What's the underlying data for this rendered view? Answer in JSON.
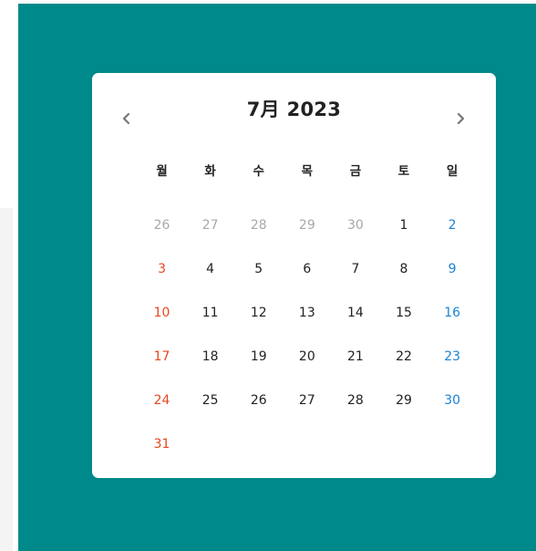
{
  "calendar": {
    "title": "7月 2023",
    "weekdays": [
      "월",
      "화",
      "수",
      "목",
      "금",
      "토",
      "일"
    ],
    "weeks": [
      [
        "26",
        "27",
        "28",
        "29",
        "30",
        "1",
        "2"
      ],
      [
        "3",
        "4",
        "5",
        "6",
        "7",
        "8",
        "9"
      ],
      [
        "10",
        "11",
        "12",
        "13",
        "14",
        "15",
        "16"
      ],
      [
        "17",
        "18",
        "19",
        "20",
        "21",
        "22",
        "23"
      ],
      [
        "24",
        "25",
        "26",
        "27",
        "28",
        "29",
        "30"
      ],
      [
        "31",
        "",
        "",
        "",
        "",
        "",
        ""
      ]
    ],
    "icons": {
      "prev": "chevron-left-icon",
      "next": "chevron-right-icon"
    },
    "colors": {
      "backdrop": "#00898a",
      "sunday": "#e8471f",
      "saturday": "#1a83d6",
      "muted": "#a8a8a8"
    }
  }
}
